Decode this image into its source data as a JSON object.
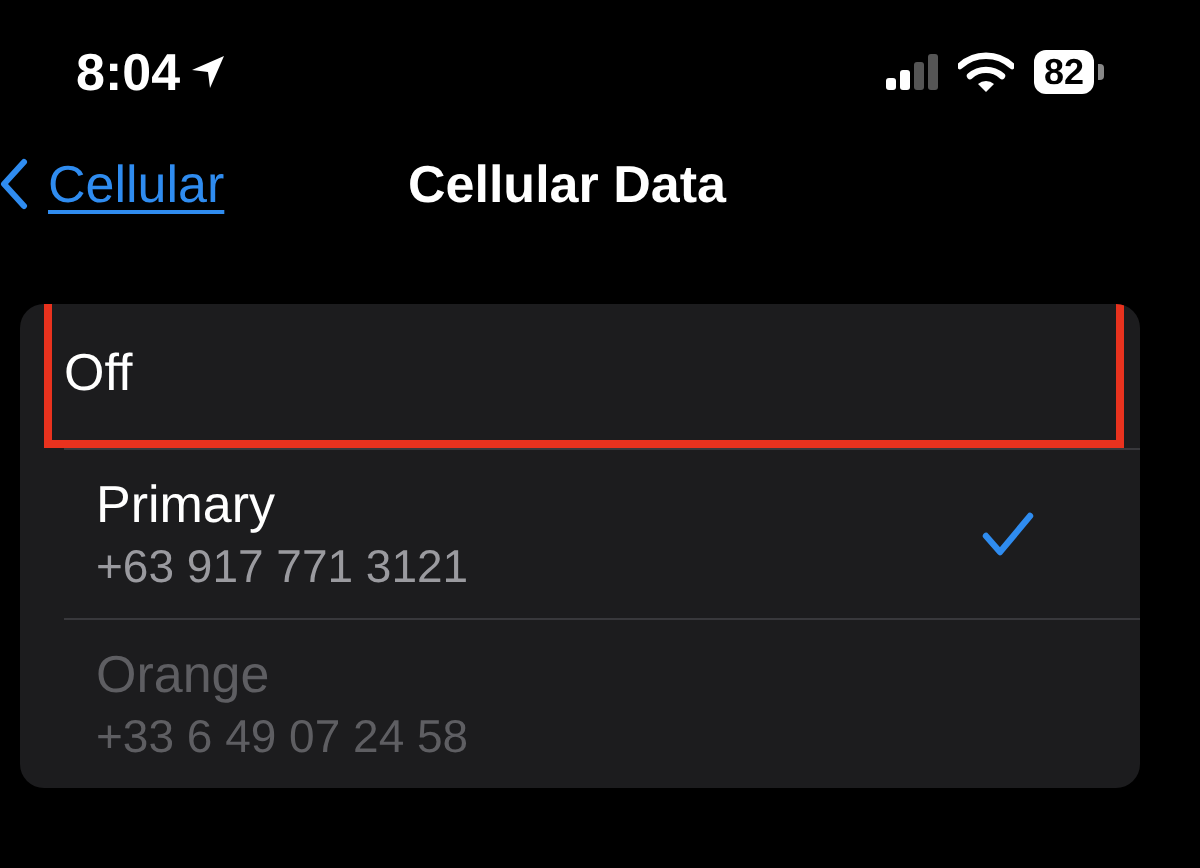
{
  "status_bar": {
    "time": "8:04",
    "battery": "82"
  },
  "nav": {
    "back": "Cellular",
    "title": "Cellular Data"
  },
  "options": [
    {
      "label": "Off",
      "highlighted": true,
      "selected": false,
      "disabled": false
    },
    {
      "label": "Primary",
      "number": "+63 917 771 3121",
      "highlighted": false,
      "selected": true,
      "disabled": false
    },
    {
      "label": "Orange",
      "number": "+33 6 49 07 24 58",
      "highlighted": false,
      "selected": false,
      "disabled": true
    }
  ]
}
